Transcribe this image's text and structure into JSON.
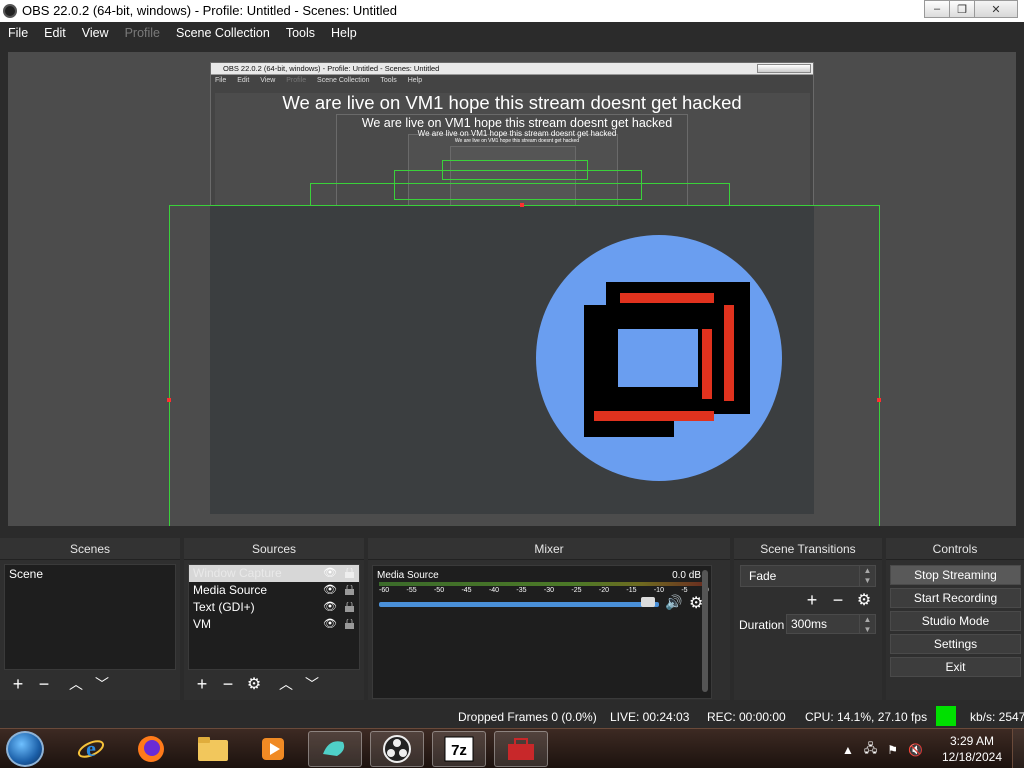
{
  "window": {
    "title": "OBS 22.0.2 (64-bit, windows) - Profile: Untitled - Scenes: Untitled",
    "minimize": "–",
    "maximize": "❐",
    "close": "✕"
  },
  "menu": [
    "File",
    "Edit",
    "View",
    "Profile",
    "Scene Collection",
    "Tools",
    "Help"
  ],
  "preview": {
    "nested_title": "OBS 22.0.2 (64-bit, windows) - Profile: Untitled - Scenes: Untitled",
    "nested_menu": [
      "File",
      "Edit",
      "View",
      "Profile",
      "Scene Collection",
      "Tools",
      "Help"
    ],
    "overlay_text": "We are live on VM1 hope this stream doesnt get hacked"
  },
  "docks": {
    "scenes": {
      "title": "Scenes",
      "items": [
        "Scene"
      ]
    },
    "sources": {
      "title": "Sources",
      "items": [
        {
          "name": "Window Capture",
          "selected": true
        },
        {
          "name": "Media Source",
          "selected": false
        },
        {
          "name": "Text (GDI+)",
          "selected": false
        },
        {
          "name": "VM",
          "selected": false
        }
      ]
    },
    "mixer": {
      "title": "Mixer",
      "channel": "Media Source",
      "db": "0.0 dB",
      "ticks": [
        "-60",
        "-55",
        "-50",
        "-45",
        "-40",
        "-35",
        "-30",
        "-25",
        "-20",
        "-15",
        "-10",
        "-5",
        "0"
      ]
    },
    "transitions": {
      "title": "Scene Transitions",
      "selected": "Fade",
      "duration_label": "Duration",
      "duration_value": "300ms"
    },
    "controls": {
      "title": "Controls",
      "buttons": [
        "Stop Streaming",
        "Start Recording",
        "Studio Mode",
        "Settings",
        "Exit"
      ]
    }
  },
  "status": {
    "dropped": "Dropped Frames 0 (0.0%)",
    "live": "LIVE: 00:24:03",
    "rec": "REC: 00:00:00",
    "cpu": "CPU: 14.1%, 27.10 fps",
    "kbs": "kb/s: 2547",
    "indicator_color": "#00e000"
  },
  "taskbar": {
    "time": "3:29 AM",
    "date": "12/18/2024"
  },
  "colors": {
    "accent_blue": "#4a90d9",
    "source_green": "#3ad13a",
    "logo_blue": "#6a9ef0",
    "logo_red": "#e0321e"
  }
}
